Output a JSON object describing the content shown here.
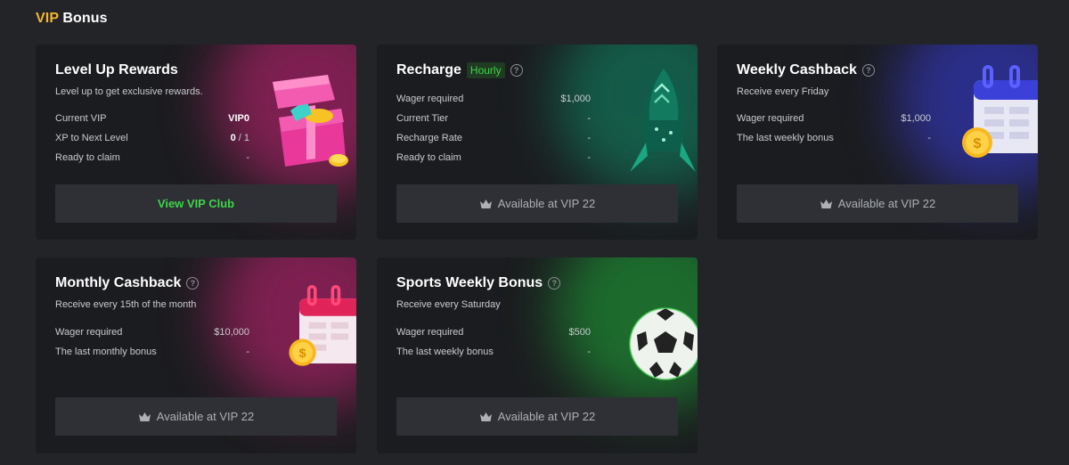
{
  "header": {
    "title_accent": "VIP",
    "title_rest": "Bonus",
    "accent_color": "#f2b632"
  },
  "cards": {
    "level_up": {
      "title": "Level Up Rewards",
      "subtitle": "Level up to get exclusive rewards.",
      "rows": [
        {
          "label": "Current VIP",
          "value": "VIP0"
        },
        {
          "label": "XP to Next Level",
          "value_bold": "0",
          "value_rest": " / 1"
        },
        {
          "label": "Ready to claim",
          "value": "-"
        }
      ],
      "button": "View VIP Club",
      "art_icon": "gift-box-icon"
    },
    "recharge": {
      "title": "Recharge",
      "tag": "Hourly",
      "rows": [
        {
          "label": "Wager required",
          "value": "$1,000"
        },
        {
          "label": "Current Tier",
          "value": "-"
        },
        {
          "label": "Recharge Rate",
          "value": "-"
        },
        {
          "label": "Ready to claim",
          "value": "-"
        }
      ],
      "button": "Available at VIP 22",
      "art_icon": "rocket-icon"
    },
    "weekly_cashback": {
      "title": "Weekly Cashback",
      "subtitle": "Receive every Friday",
      "rows": [
        {
          "label": "Wager required",
          "value": "$1,000"
        },
        {
          "label": "The last weekly bonus",
          "value": "-"
        }
      ],
      "button": "Available at VIP 22",
      "art_icon": "calendar-coin-icon"
    },
    "monthly_cashback": {
      "title": "Monthly Cashback",
      "subtitle": "Receive every 15th of the month",
      "rows": [
        {
          "label": "Wager required",
          "value": "$10,000"
        },
        {
          "label": "The last monthly bonus",
          "value": "-"
        }
      ],
      "button": "Available at VIP 22",
      "art_icon": "calendar-coin-icon"
    },
    "sports_weekly": {
      "title": "Sports Weekly Bonus",
      "subtitle": "Receive every Saturday",
      "rows": [
        {
          "label": "Wager required",
          "value": "$500"
        },
        {
          "label": "The last weekly bonus",
          "value": "-"
        }
      ],
      "button": "Available at VIP 22",
      "art_icon": "soccer-ball-icon"
    }
  },
  "colors": {
    "background": "#232428",
    "card": "#1b1c1f",
    "button": "#2e3036",
    "green": "#3fd44a"
  }
}
